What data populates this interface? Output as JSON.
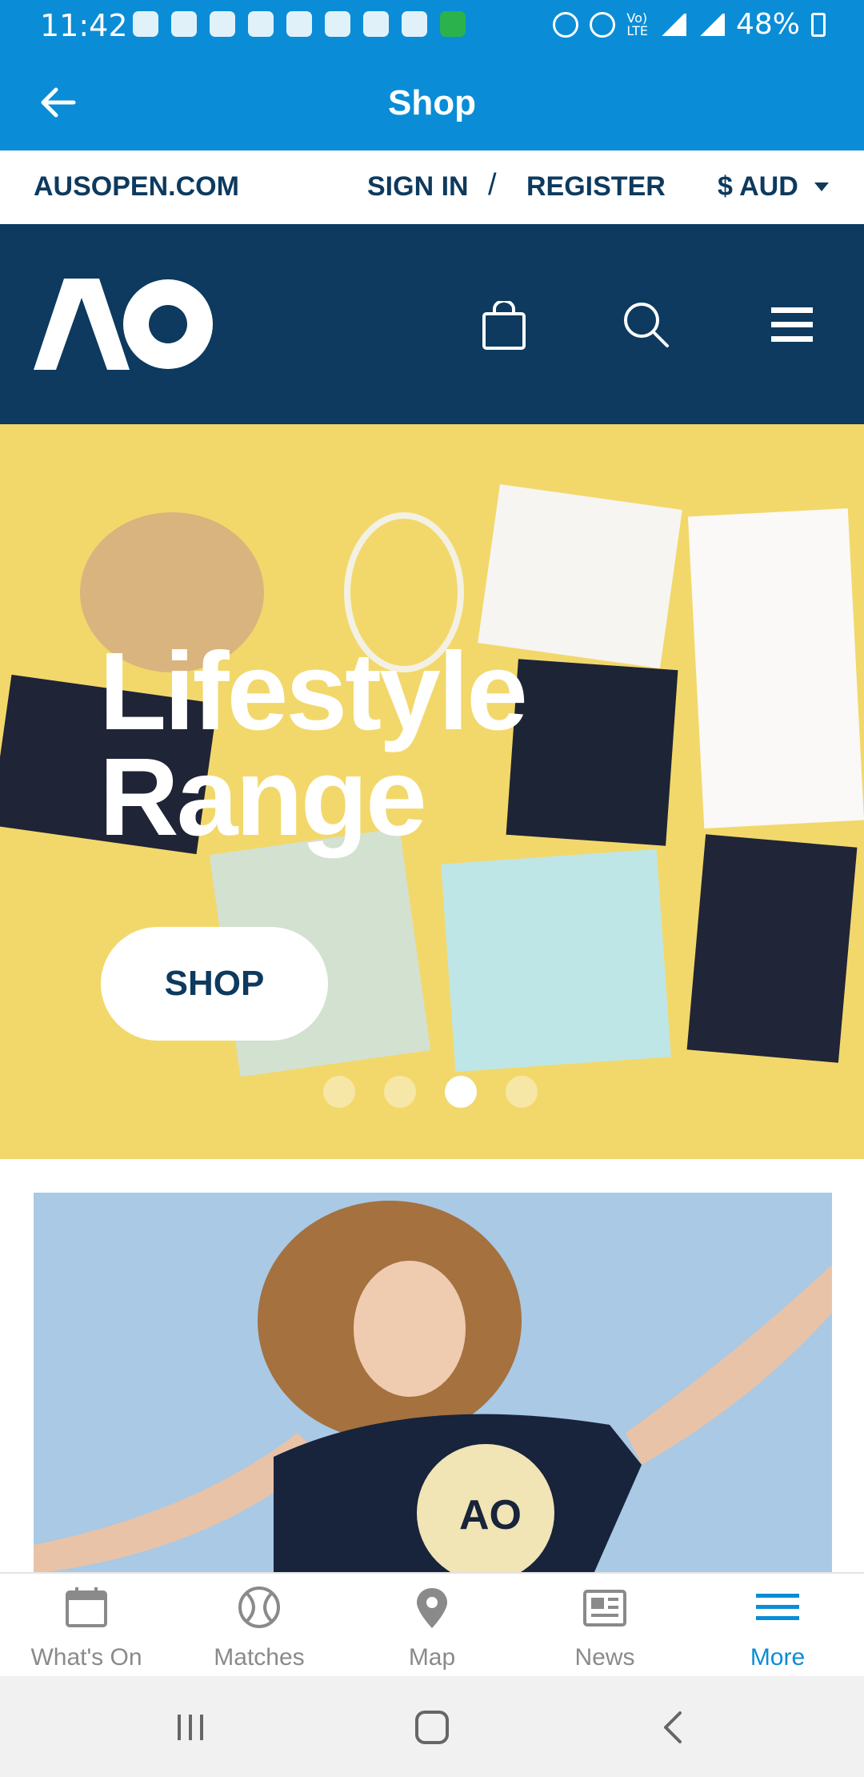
{
  "status_bar": {
    "time": "11:42",
    "battery": "48%"
  },
  "app_bar": {
    "title": "Shop"
  },
  "utility_bar": {
    "site_link": "AUSOPEN.COM",
    "sign_in": "SIGN IN",
    "separator": "/",
    "register": "REGISTER",
    "currency": "$ AUD"
  },
  "hero": {
    "headline_line1": "Lifestyle",
    "headline_line2": "Range",
    "shop_button": "SHOP",
    "slides": 4,
    "active_slide": 3
  },
  "bottom_nav": {
    "items": [
      {
        "label": "What's On",
        "icon": "calendar-icon"
      },
      {
        "label": "Matches",
        "icon": "tennis-ball-icon"
      },
      {
        "label": "Map",
        "icon": "map-pin-icon"
      },
      {
        "label": "News",
        "icon": "newspaper-icon"
      },
      {
        "label": "More",
        "icon": "menu-icon"
      }
    ],
    "active_index": 4
  },
  "colors": {
    "primary_blue": "#0a8dd6",
    "navy": "#0d3a5e",
    "hero_yellow": "#f2d86b"
  }
}
